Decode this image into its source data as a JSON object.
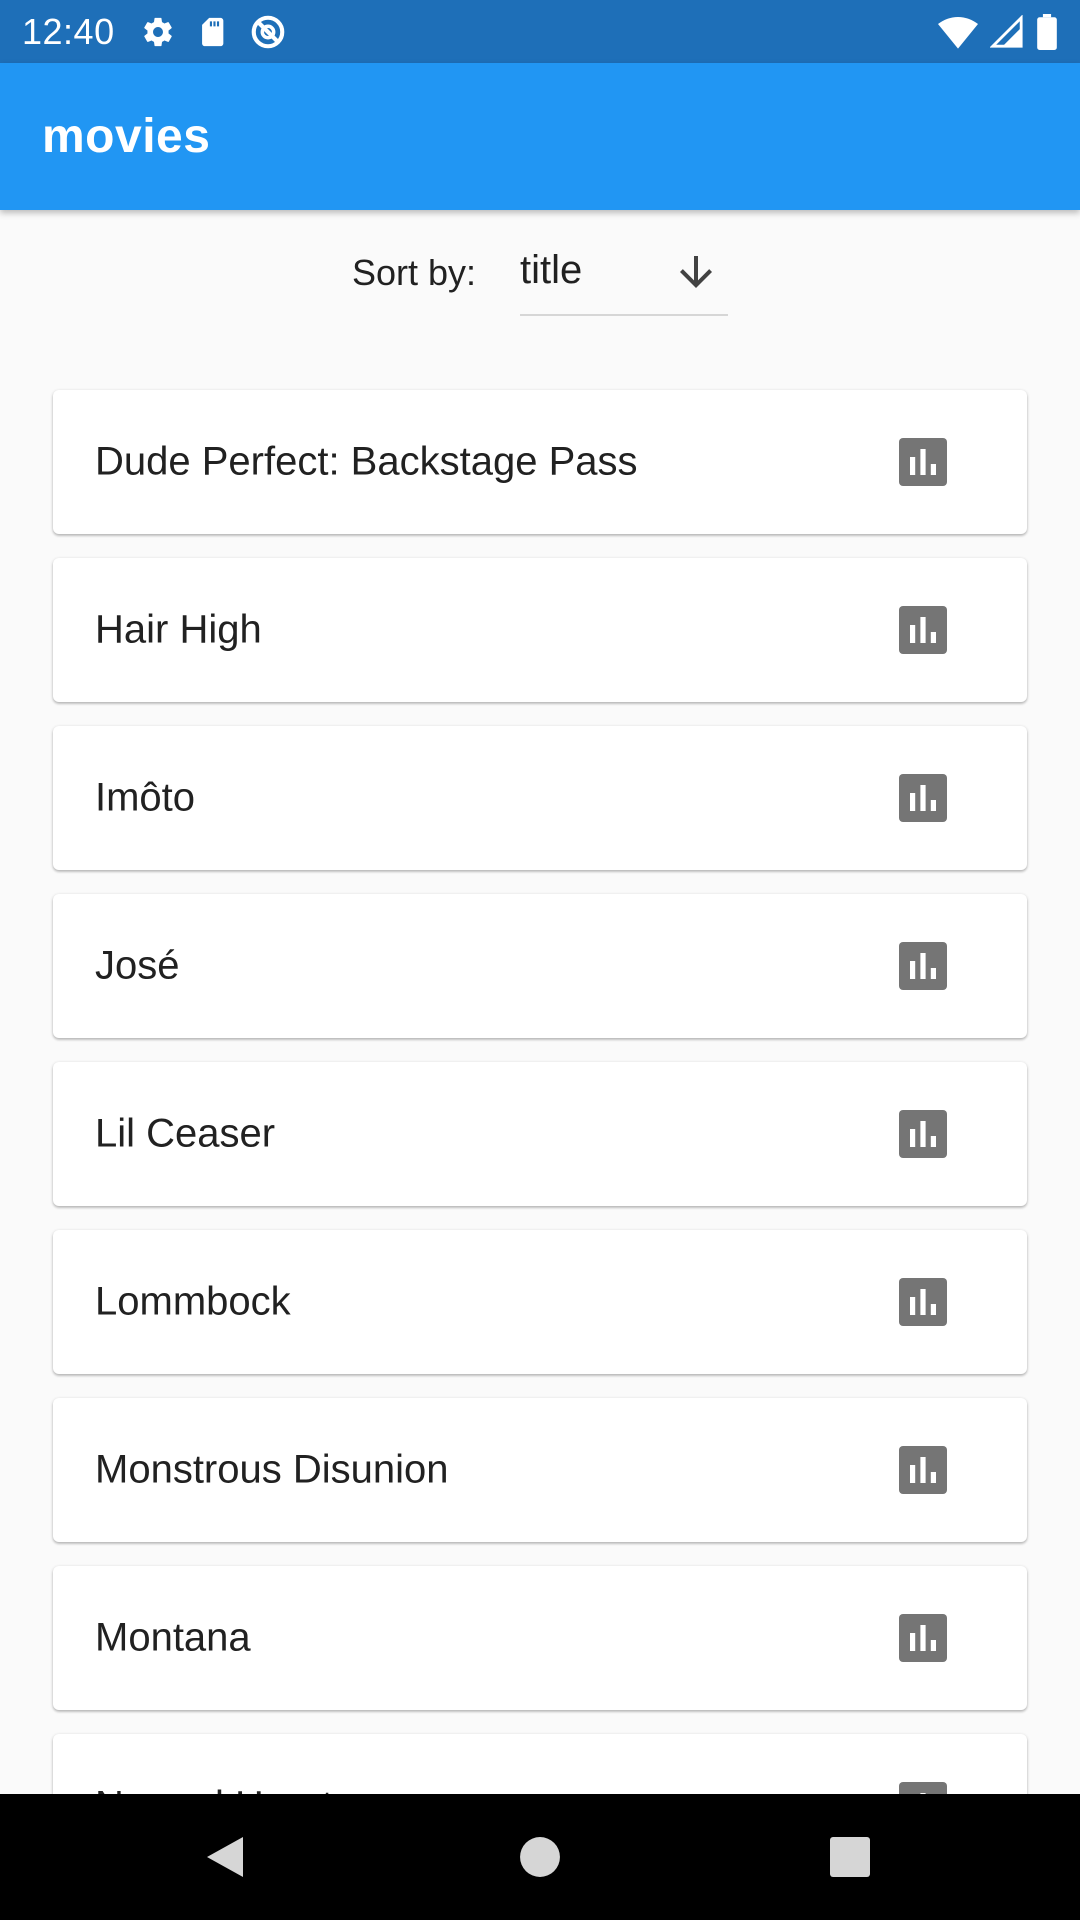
{
  "status_bar": {
    "time": "12:40",
    "left_icons": [
      "settings-icon",
      "sd-card-icon",
      "do-not-disturb-icon"
    ],
    "right_icons": [
      "wifi-icon",
      "cell-signal-icon",
      "battery-icon"
    ]
  },
  "app_bar": {
    "title": "movies"
  },
  "sort": {
    "label": "Sort by:",
    "selected": "title",
    "icon": "arrow-down-icon"
  },
  "movies": [
    {
      "title": "Dude Perfect: Backstage Pass",
      "icon": "bar-chart-icon"
    },
    {
      "title": "Hair High",
      "icon": "bar-chart-icon"
    },
    {
      "title": "Imôto",
      "icon": "bar-chart-icon"
    },
    {
      "title": "José",
      "icon": "bar-chart-icon"
    },
    {
      "title": "Lil Ceaser",
      "icon": "bar-chart-icon"
    },
    {
      "title": "Lommbock",
      "icon": "bar-chart-icon"
    },
    {
      "title": "Monstrous Disunion",
      "icon": "bar-chart-icon"
    },
    {
      "title": "Montana",
      "icon": "bar-chart-icon"
    },
    {
      "title": "Normal Heart",
      "icon": "bar-chart-icon"
    }
  ],
  "nav_bar": {
    "buttons": [
      "back-icon",
      "home-icon",
      "recents-icon"
    ]
  },
  "colors": {
    "status_bar": "#1e6fb8",
    "app_bar": "#2196f3",
    "background": "#fafafa",
    "icon_grey": "#757575"
  }
}
